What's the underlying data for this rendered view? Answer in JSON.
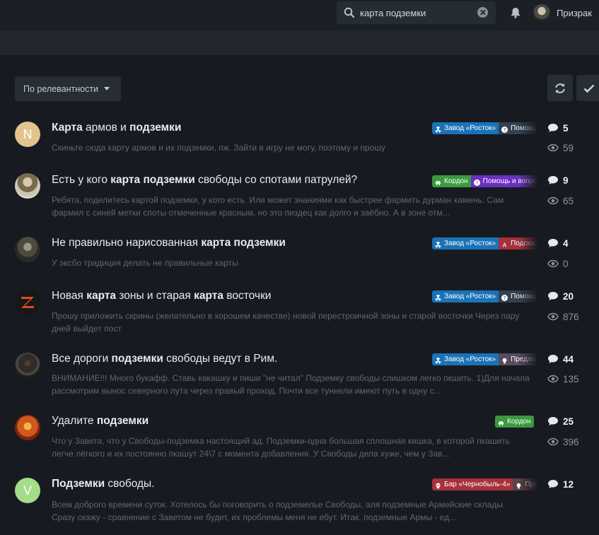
{
  "header": {
    "search_value": "карта подземки",
    "user_name": "Призрак"
  },
  "toolbar": {
    "sort_label": "По релевантности"
  },
  "topics": [
    {
      "avatar_letter": "N",
      "title": [
        {
          "t": "Карта",
          "b": true
        },
        {
          "t": " армов и ",
          "b": false
        },
        {
          "t": "подземки",
          "b": true
        }
      ],
      "snippet": [
        "Скиньте сюда карту армов и их подземки, пж. Зайти в игру не могу, поэтому и прошу"
      ],
      "tags": [
        {
          "label": "Завод «Росток»",
          "color": "blue"
        },
        {
          "label": "Помощь",
          "color": "grey"
        }
      ],
      "replies": "5",
      "views": "59"
    },
    {
      "title": [
        {
          "t": "Есть у кого ",
          "b": false
        },
        {
          "t": "карта подземки",
          "b": true
        },
        {
          "t": " свободы со спотами патрулей?",
          "b": false
        }
      ],
      "snippet": [
        "Ребята, поделитесь картой подземки, у кого есть. Или может знаниями как быстрее фармить дурман камень. Сам",
        "фармил с синей метки споты отмеченные красным, но это пиздец как долго и заёбно. А в зоне отм..."
      ],
      "tags": [
        {
          "label": "Кордон",
          "color": "green"
        },
        {
          "label": "Помощь и вопросы",
          "color": "purple"
        }
      ],
      "replies": "9",
      "views": "65"
    },
    {
      "title": [
        {
          "t": "Не правильно нарисованная ",
          "b": false
        },
        {
          "t": "карта подземки",
          "b": true
        }
      ],
      "snippet": [
        "У эксбо традиция делать не правильные карты"
      ],
      "tags": [
        {
          "label": "Завод «Росток»",
          "color": "blue"
        },
        {
          "label": "Подсказки",
          "color": "red"
        }
      ],
      "replies": "4",
      "views": "0"
    },
    {
      "title": [
        {
          "t": "Новая ",
          "b": false
        },
        {
          "t": "карта",
          "b": true
        },
        {
          "t": " зоны и старая ",
          "b": false
        },
        {
          "t": "карта",
          "b": true
        },
        {
          "t": " восточки",
          "b": false
        }
      ],
      "snippet": [
        "Прошу приложить скрины (желательно в хорошем качестве) новой перестроичной зоны и старой восточки Через пару",
        "дней выйдет пост"
      ],
      "tags": [
        {
          "label": "Завод «Росток»",
          "color": "blue"
        },
        {
          "label": "Помощь",
          "color": "grey"
        }
      ],
      "replies": "20",
      "views": "876"
    },
    {
      "title": [
        {
          "t": "Все дороги ",
          "b": false
        },
        {
          "t": "подземки",
          "b": true
        },
        {
          "t": " свободы ведут в Рим.",
          "b": false
        }
      ],
      "snippet": [
        "ВНИМАНИЕ!!! Много букафф. Ставь какашку и пиши \"не читал\" Подземку свободы слишком легко пкшить. 1)Для начала",
        "рассмотрим вынос северного лута через правый проход. Почти все туннели имеют путь в одну с..."
      ],
      "tags": [
        {
          "label": "Завод «Росток»",
          "color": "blue"
        },
        {
          "label": "Предложения",
          "color": "mauve"
        }
      ],
      "replies": "44",
      "views": "135"
    },
    {
      "title": [
        {
          "t": "Удалите ",
          "b": false
        },
        {
          "t": "подземки",
          "b": true
        }
      ],
      "snippet": [
        "Что у Завета, что у Свободы-подземка настоящий ад. Подземки-одна большая сплошная кишка, в которой пкашить",
        "легче лёгкого и их постоянно пкашут 24\\7 с момента добавления. У Свободы дела хуже, чем у Зав..."
      ],
      "tags": [
        {
          "label": "Кордон",
          "color": "green"
        }
      ],
      "replies": "25",
      "views": "396"
    },
    {
      "avatar_letter": "V",
      "title": [
        {
          "t": "Подземки",
          "b": true
        },
        {
          "t": " свободы.",
          "b": false
        }
      ],
      "snippet": [
        "Всем доброго времени суток. Хотелось бы поговорить о подземелье Свободы, аля подземные Армейские склады.",
        "Сразу скажу - сравнение с Заветом не будет, их проблемы меня не ебут. Итак, подземные Армы - ед..."
      ],
      "tags": [
        {
          "label": "Бар «Чернобыль-4»",
          "color": "red"
        },
        {
          "label": "Предложения",
          "color": "brown"
        }
      ],
      "replies": "12",
      "views": ""
    }
  ]
}
